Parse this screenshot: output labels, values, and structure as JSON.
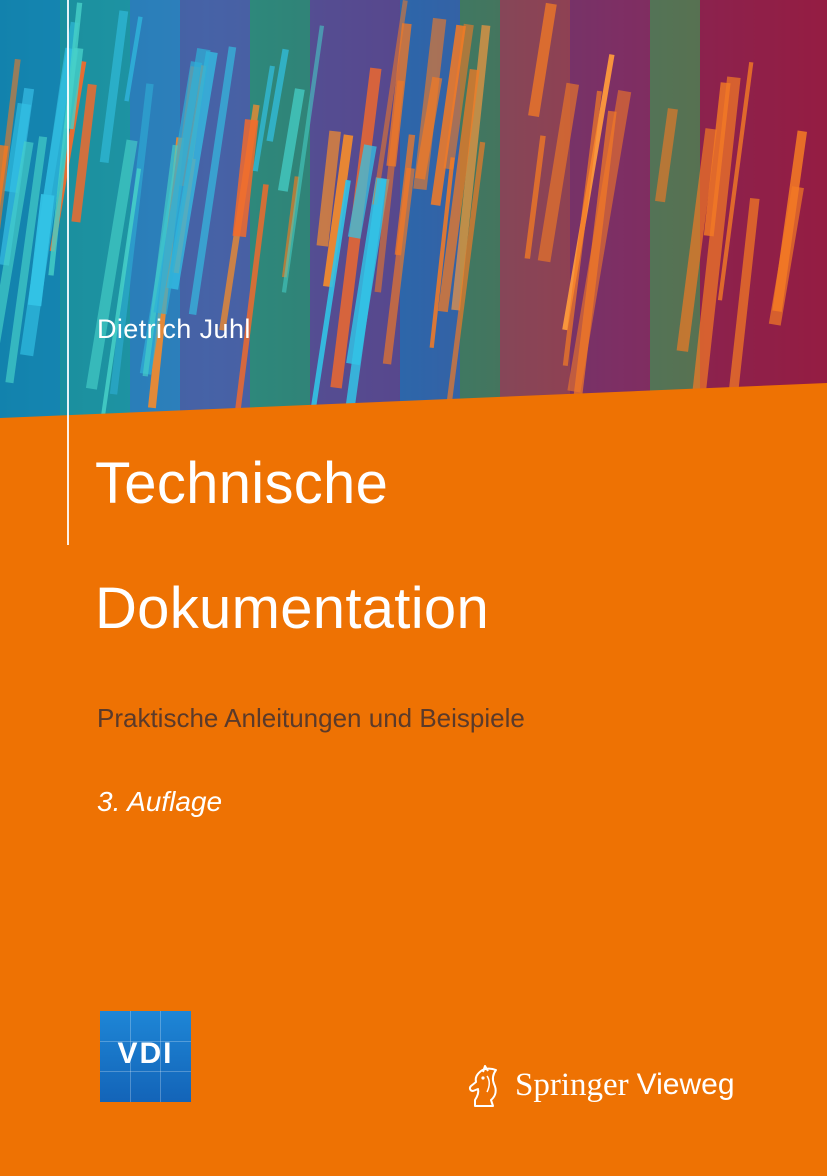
{
  "cover": {
    "author": "Dietrich Juhl",
    "title_line1": "Technische",
    "title_line2": "Dokumentation",
    "subtitle": "Praktische Anleitungen und Beispiele",
    "edition": "3. Auflage",
    "logo_text": "VDI",
    "publisher": "Springer",
    "imprint": "Vieweg",
    "colors": {
      "background": "#ee7203",
      "title_text": "#ffffff",
      "subtitle_text": "#5b3a2a",
      "vdi_blue": "#1870c7"
    }
  }
}
